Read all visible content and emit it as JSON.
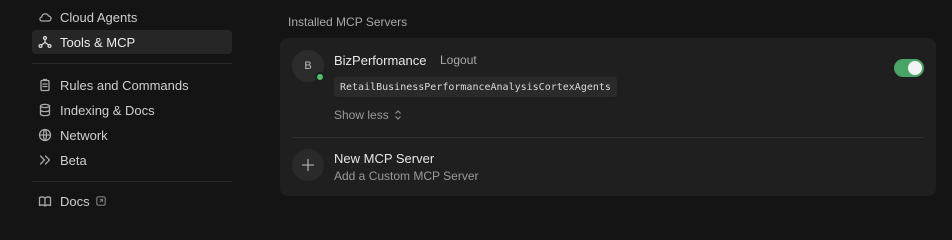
{
  "sidebar": {
    "items": [
      {
        "label": "Cloud Agents",
        "icon": "cloud-icon"
      },
      {
        "label": "Tools & MCP",
        "icon": "tools-icon",
        "active": true
      },
      {
        "label": "Rules and Commands",
        "icon": "clipboard-icon"
      },
      {
        "label": "Indexing & Docs",
        "icon": "database-icon"
      },
      {
        "label": "Network",
        "icon": "globe-icon"
      },
      {
        "label": "Beta",
        "icon": "double-chevron-right-icon"
      },
      {
        "label": "Docs",
        "icon": "book-icon",
        "external_icon": "external-link-icon"
      }
    ]
  },
  "main": {
    "section_title": "Installed MCP Servers",
    "server": {
      "avatar_letter": "B",
      "name": "BizPerformance",
      "logout_label": "Logout",
      "tool": "RetailBusinessPerformanceAnalysisCortexAgents",
      "show_less_label": "Show less",
      "enabled": true,
      "status": "connected"
    },
    "new_server": {
      "title": "New MCP Server",
      "subtitle": "Add a Custom MCP Server"
    }
  },
  "colors": {
    "background": "#141414",
    "card": "#1f1f1f",
    "toggle_on": "#4aa466",
    "status_dot": "#4fbf6b"
  }
}
